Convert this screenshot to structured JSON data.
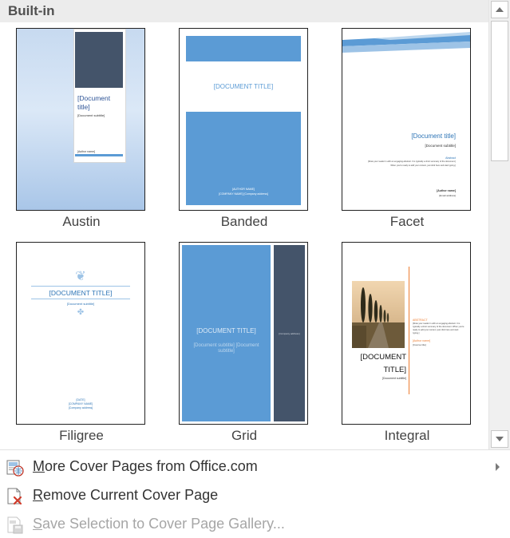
{
  "header": {
    "title": "Built-in"
  },
  "templates": [
    {
      "name": "Austin",
      "title_text": "[Document title]",
      "subtitle_text": "[Document subtitle]",
      "author_text": "[Author name]"
    },
    {
      "name": "Banded",
      "title_text": "[DOCUMENT TITLE]",
      "author_text": "[AUTHOR NAME]",
      "company_text": "[COMPANY NAME] [Company address]"
    },
    {
      "name": "Facet",
      "title_text": "[Document title]",
      "subtitle_text": "[Document subtitle]",
      "abstract_label": "Abstract",
      "abstract_text": "[Draw your reader in with an engaging abstract. It is typically a short summary of the document.]",
      "abstract_text2": "When you're ready to add your content, just click here and start typing.]",
      "author_text": "[Author name]",
      "email_text": "[Email address]"
    },
    {
      "name": "Filigree",
      "title_text": "[DOCUMENT TITLE]",
      "subtitle_text": "[Document subtitle]",
      "date_text": "[DATE]",
      "company_text": "[COMPANY NAME]",
      "address_text": "[Company address]"
    },
    {
      "name": "Grid",
      "title_text": "[DOCUMENT TITLE]",
      "subtitle_text": "[Document subtitle] [Document subtitle]",
      "side_text": "[Company address]"
    },
    {
      "name": "Integral",
      "title_text": "[DOCUMENT TITLE]",
      "subtitle_text": "[Document subtitle]",
      "abstract_label": "ABSTRACT",
      "abstract_text": "[Draw your reader in with an engaging abstract. It is typically a short summary of the document. When you're ready to add your content, just click here and start typing.]",
      "author_text": "[Author name]",
      "course_text": "[Course title]"
    }
  ],
  "menu": {
    "more_cover_pages": {
      "accesskey": "M",
      "rest": "ore Cover Pages from Office.com"
    },
    "remove_cover_page": {
      "accesskey": "R",
      "rest": "emove Current Cover Page"
    },
    "save_selection": {
      "accesskey": "S",
      "rest": "ave Selection to Cover Page Gallery..."
    }
  },
  "colors": {
    "accent_blue": "#5b9bd5",
    "dark_slate": "#44546a",
    "menu_icon_red": "#c0392b"
  }
}
